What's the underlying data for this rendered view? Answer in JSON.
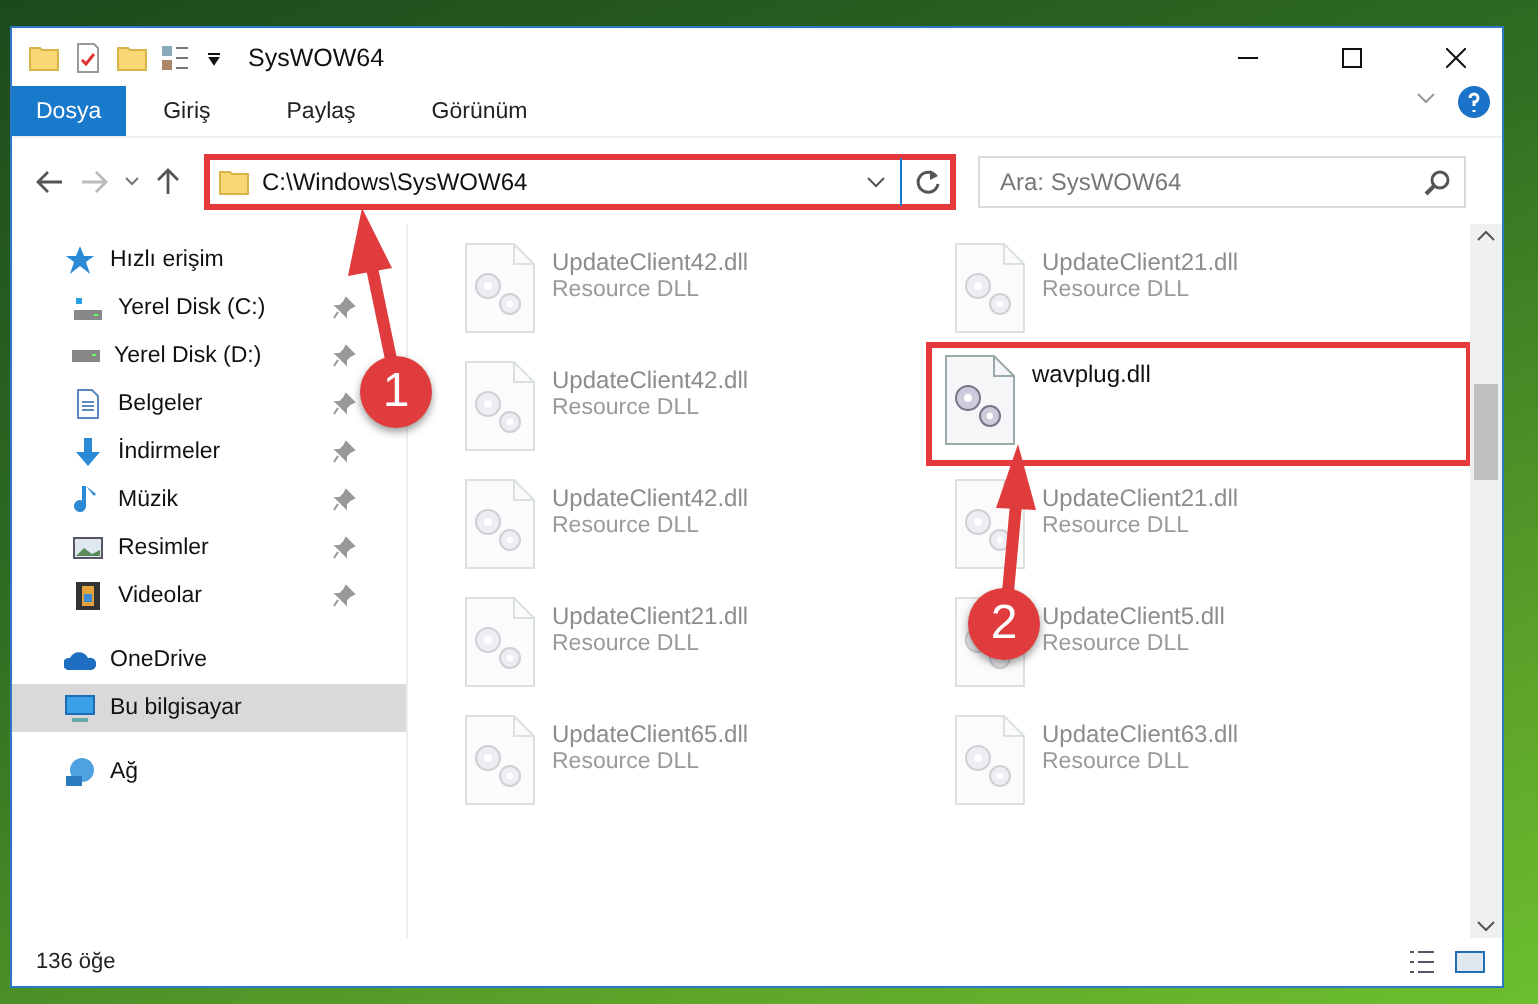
{
  "window": {
    "title": "SysWOW64"
  },
  "ribbon_tabs": [
    {
      "label": "Dosya",
      "selected": true
    },
    {
      "label": "Giriş",
      "selected": false
    },
    {
      "label": "Paylaş",
      "selected": false
    },
    {
      "label": "Görünüm",
      "selected": false
    }
  ],
  "address": {
    "path": "C:\\Windows\\SysWOW64",
    "annotated": true
  },
  "search": {
    "placeholder": "Ara: SysWOW64"
  },
  "sidebar": {
    "items": [
      {
        "label": "Hızlı erişim",
        "kind": "quick",
        "selected": false,
        "pinned": false
      },
      {
        "label": "Yerel Disk (C:)",
        "kind": "drive-c",
        "selected": false,
        "pinned": true
      },
      {
        "label": "Yerel Disk (D:)",
        "kind": "drive",
        "selected": false,
        "pinned": true
      },
      {
        "label": "Belgeler",
        "kind": "documents",
        "selected": false,
        "pinned": true
      },
      {
        "label": "İndirmeler",
        "kind": "downloads",
        "selected": false,
        "pinned": true
      },
      {
        "label": "Müzik",
        "kind": "music",
        "selected": false,
        "pinned": true
      },
      {
        "label": "Resimler",
        "kind": "pictures",
        "selected": false,
        "pinned": true
      },
      {
        "label": "Videolar",
        "kind": "videos",
        "selected": false,
        "pinned": true
      },
      {
        "label": "OneDrive",
        "kind": "cloud",
        "selected": false,
        "pinned": false
      },
      {
        "label": "Bu bilgisayar",
        "kind": "computer",
        "selected": true,
        "pinned": false
      },
      {
        "label": "Ağ",
        "kind": "network",
        "selected": false,
        "pinned": false
      }
    ]
  },
  "files": [
    {
      "name": "UpdateClient42.dll",
      "type": "Resource DLL",
      "blurred": true,
      "annotated": false
    },
    {
      "name": "UpdateClient21.dll",
      "type": "Resource DLL",
      "blurred": true,
      "annotated": false
    },
    {
      "name": "UpdateClient42.dll",
      "type": "Resource DLL",
      "blurred": true,
      "annotated": false
    },
    {
      "name": "wavplug.dll",
      "blurred": false,
      "annotated": true
    },
    {
      "name": "UpdateClient42.dll",
      "type": "Resource DLL",
      "blurred": true,
      "annotated": false
    },
    {
      "name": "UpdateClient21.dll",
      "type": "Resource DLL",
      "blurred": true,
      "annotated": false
    },
    {
      "name": "UpdateClient21.dll",
      "type": "Resource DLL",
      "blurred": true,
      "annotated": false
    },
    {
      "name": "UpdateClient5.dll",
      "type": "Resource DLL",
      "blurred": true,
      "annotated": false
    },
    {
      "name": "UpdateClient65.dll",
      "type": "Resource DLL",
      "blurred": true,
      "annotated": false
    },
    {
      "name": "UpdateClient63.dll",
      "type": "Resource DLL",
      "blurred": true,
      "annotated": false
    }
  ],
  "callouts": [
    {
      "number": "1"
    },
    {
      "number": "2"
    }
  ],
  "status_bar": {
    "item_count": "136 öğe"
  }
}
